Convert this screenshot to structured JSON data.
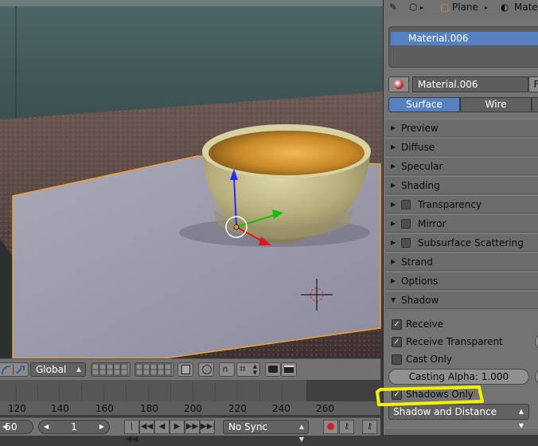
{
  "viewport": {
    "header": {
      "orientation_label": "Global",
      "orientation_options": [
        "Global"
      ]
    }
  },
  "timeline": {
    "frame_labels": [
      "120",
      "140",
      "160",
      "180",
      "200",
      "220",
      "240",
      "260"
    ]
  },
  "playback": {
    "start_frame": "50",
    "current_frame": "1",
    "sync_mode": "No Sync"
  },
  "properties": {
    "breadcrumb": {
      "object": "Plane",
      "material": "Materi"
    },
    "material_slots": [
      "Material.006"
    ],
    "material_name": "Material.006",
    "fake_user_label": "F",
    "preview_type_tabs": [
      "Surface",
      "Wire"
    ],
    "panels": [
      {
        "label": "Preview",
        "has_checkbox": false
      },
      {
        "label": "Diffuse",
        "has_checkbox": false
      },
      {
        "label": "Specular",
        "has_checkbox": false
      },
      {
        "label": "Shading",
        "has_checkbox": false
      },
      {
        "label": "Transparency",
        "has_checkbox": true
      },
      {
        "label": "Mirror",
        "has_checkbox": true
      },
      {
        "label": "Subsurface Scattering",
        "has_checkbox": true
      },
      {
        "label": "Strand",
        "has_checkbox": false
      },
      {
        "label": "Options",
        "has_checkbox": false
      }
    ],
    "shadow_panel": {
      "label": "Shadow",
      "receive_label": "Receive",
      "receive_checked": true,
      "receive_transparent_label": "Receive Transparent",
      "receive_transparent_checked": true,
      "cast_only_label": "Cast Only",
      "cast_only_checked": false,
      "casting_alpha_label": "Casting Alpha: 1.000",
      "shadows_only_label": "Shadows Only",
      "shadows_only_checked": true,
      "shadow_mode_label": "Shadow and Distance"
    }
  },
  "colors": {
    "accent_blue": "#5680c2",
    "highlight_yellow": "#f2f200",
    "selection_orange": "#f0a030"
  }
}
